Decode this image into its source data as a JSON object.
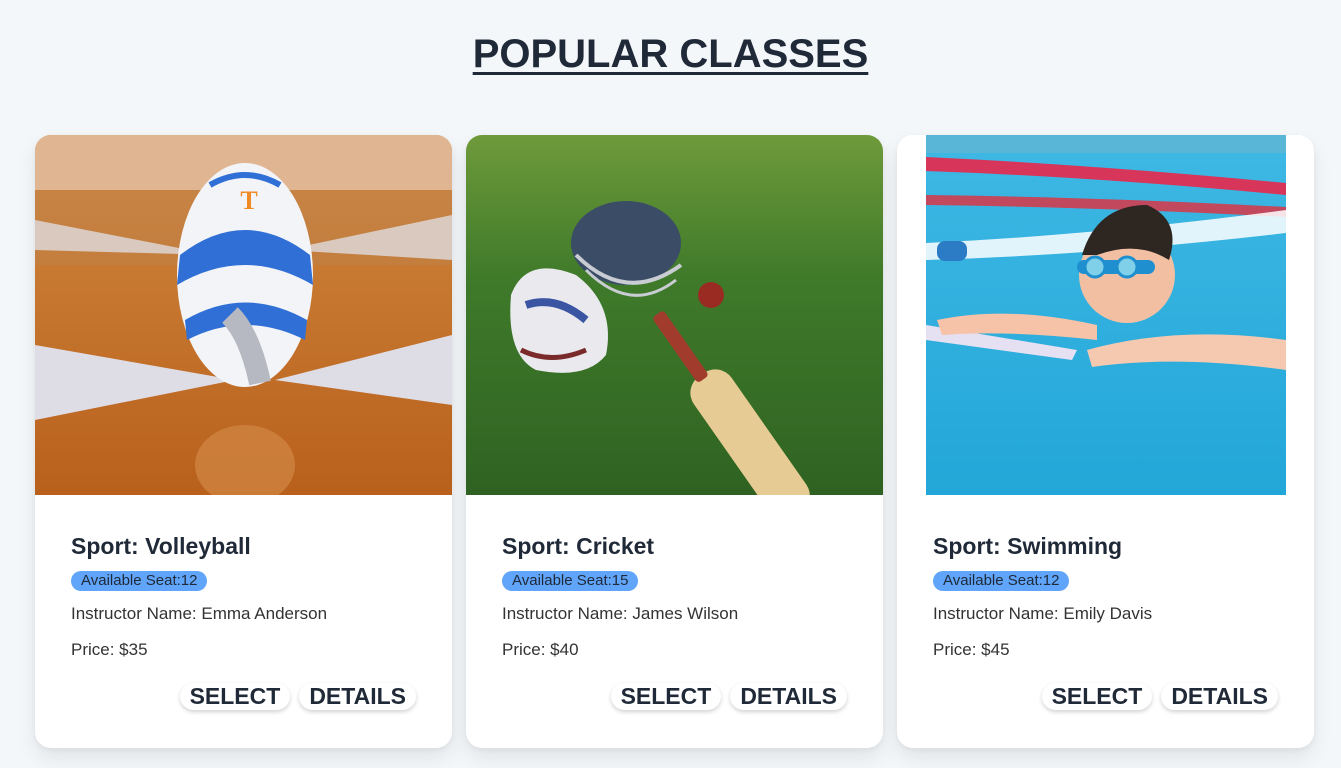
{
  "page": {
    "title": "POPULAR CLASSES"
  },
  "classes": [
    {
      "sport_label": "Sport: Volleyball",
      "seats_label": "Available Seat:12",
      "instructor_label": "Instructor Name: Emma Anderson",
      "price_label": "Price: $35",
      "select_label": "SELECT",
      "details_label": "DETAILS",
      "image": "volleyball-photo"
    },
    {
      "sport_label": "Sport: Cricket",
      "seats_label": "Available Seat:15",
      "instructor_label": "Instructor Name: James Wilson",
      "price_label": "Price: $40",
      "select_label": "SELECT",
      "details_label": "DETAILS",
      "image": "cricket-gear-photo"
    },
    {
      "sport_label": "Sport: Swimming",
      "seats_label": "Available Seat:12",
      "instructor_label": "Instructor Name: Emily Davis",
      "price_label": "Price: $45",
      "select_label": "SELECT",
      "details_label": "DETAILS",
      "image": "swimming-photo"
    }
  ],
  "colors": {
    "page_background": "#f4f7fa",
    "badge": "#60a5fa",
    "text": "#1f2937"
  }
}
